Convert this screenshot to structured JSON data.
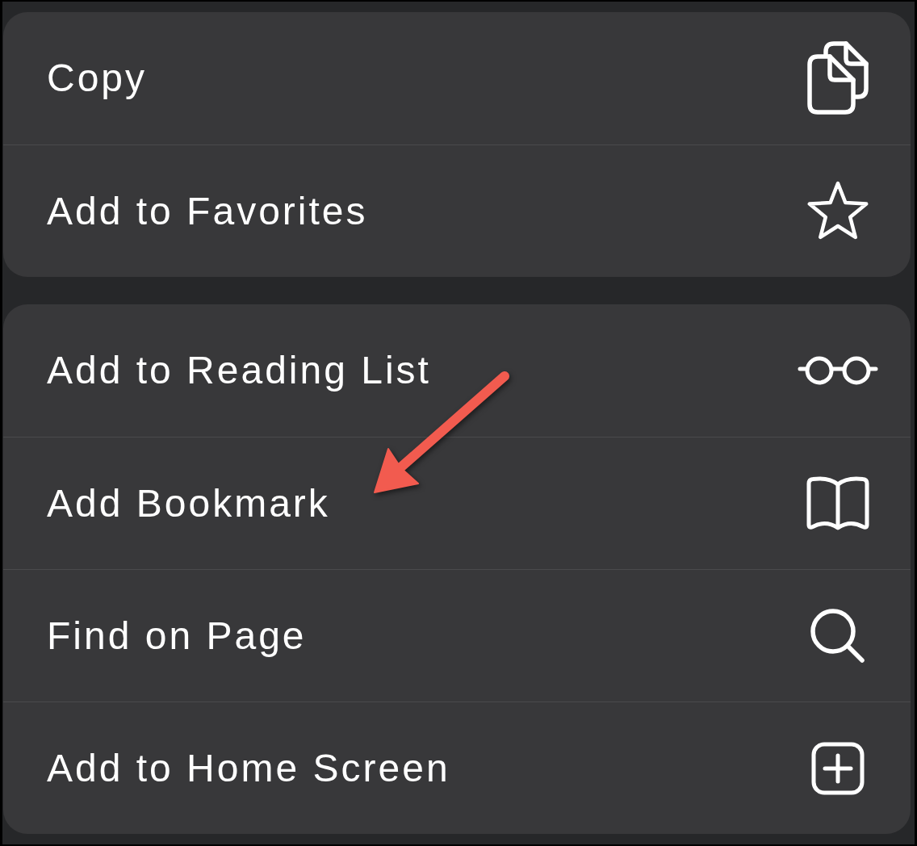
{
  "menu_groups": [
    {
      "items": [
        {
          "label": "Copy"
        },
        {
          "label": "Add to Favorites"
        }
      ]
    },
    {
      "items": [
        {
          "label": "Add to Reading List"
        },
        {
          "label": "Add Bookmark"
        },
        {
          "label": "Find on Page"
        },
        {
          "label": "Add to Home Screen"
        }
      ]
    }
  ]
}
